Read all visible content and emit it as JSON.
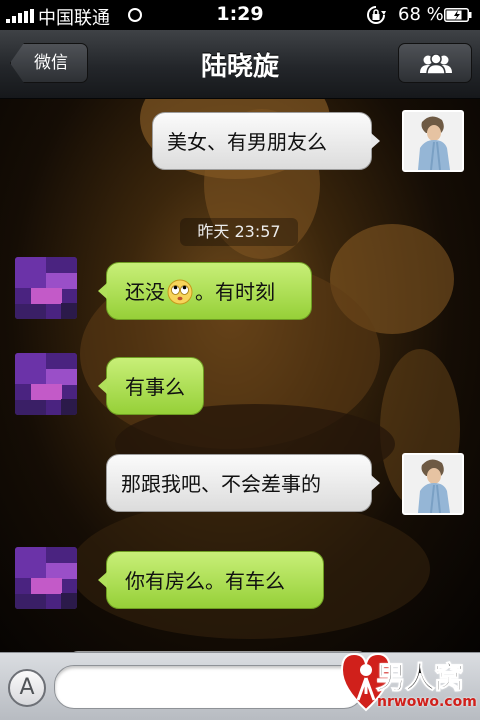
{
  "status_bar": {
    "carrier": "中国联通",
    "time": "1:29",
    "battery_percent": "68 %",
    "icons": [
      "signal-bars-icon",
      "wifi-icon",
      "rotation-lock-icon",
      "battery-icon"
    ]
  },
  "nav": {
    "back_label": "微信",
    "title": "陆晓旋",
    "right_icon": "contacts-icon"
  },
  "chat": {
    "timestamp": "昨天 23:57",
    "messages": [
      {
        "side": "self",
        "text": "美女、有男朋友么"
      },
      {
        "side": "other",
        "text_before": "还没",
        "emoji": "eye-roll-emoji-icon",
        "text_after": "。有时刻"
      },
      {
        "side": "other",
        "text": "有事么"
      },
      {
        "side": "self",
        "text": "那跟我吧、不会差事的"
      },
      {
        "side": "other",
        "text": "你有房么。有车么"
      }
    ]
  },
  "input_bar": {
    "voice_toggle_label": "A",
    "message_value": "",
    "message_placeholder": ""
  },
  "watermark": {
    "title": "男人窝",
    "url": "nrwowo.com"
  },
  "colors": {
    "self_bubble": "#efefef",
    "other_bubble": "#a8dc4c",
    "nav_bar": "#2a2d31",
    "watermark_red": "#d0201b"
  }
}
